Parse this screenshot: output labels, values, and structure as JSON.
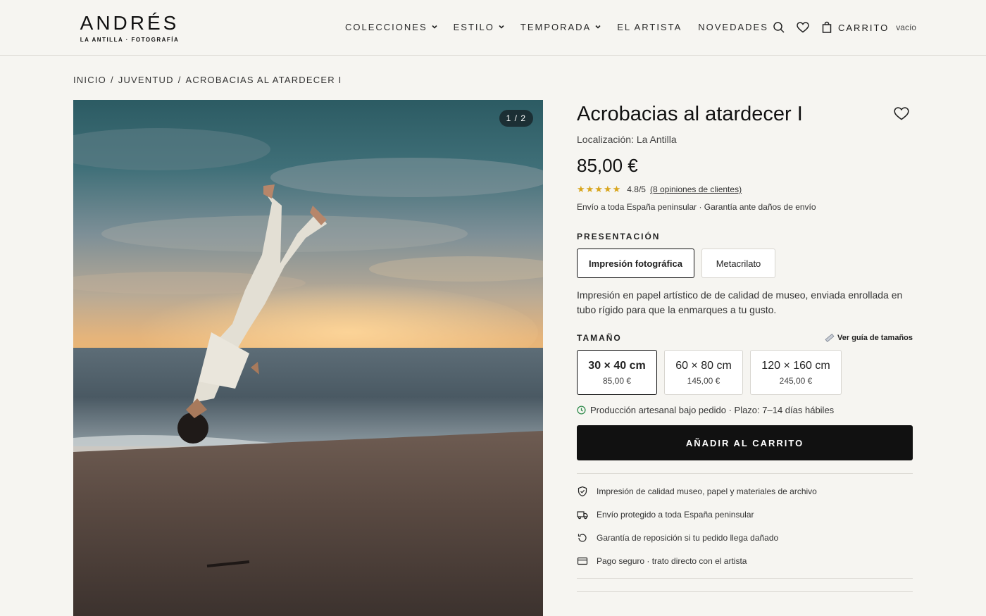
{
  "brand": {
    "name": "ANDRÉS",
    "tagline": "LA ANTILLA · FOTOGRAFÍA"
  },
  "nav": {
    "items": [
      {
        "label": "COLECCIONES",
        "dropdown": true
      },
      {
        "label": "ESTILO",
        "dropdown": true
      },
      {
        "label": "TEMPORADA",
        "dropdown": true
      },
      {
        "label": "EL ARTISTA",
        "dropdown": false
      },
      {
        "label": "NOVEDADES",
        "dropdown": false
      }
    ]
  },
  "header": {
    "cart_label": "CARRITO",
    "cart_state": "vacío"
  },
  "breadcrumb": [
    "INICIO",
    "JUVENTUD",
    "ACROBACIAS AL ATARDECER I"
  ],
  "gallery": {
    "counter": "1 / 2"
  },
  "product": {
    "title": "Acrobacias al atardecer I",
    "location": "Localización: La Antilla",
    "price": "85,00 €",
    "rating": {
      "stars": "★★★★★",
      "score": "4.8/5",
      "reviews": "(8 opiniones de clientes)"
    },
    "shipping_note": "Envío a toda España peninsular · Garantía ante daños de envío",
    "presentation": {
      "label": "PRESENTACIÓN",
      "options": [
        "Impresión fotográfica",
        "Metacrilato"
      ],
      "selected": "Impresión fotográfica",
      "description": "Impresión en papel artístico de de calidad de museo, enviada enrollada en tubo rígido para que la enmarques a tu gusto."
    },
    "size": {
      "label": "TAMAÑO",
      "guide": "Ver guía de tamaños",
      "options": [
        {
          "dim": "30 × 40 cm",
          "price": "85,00 €"
        },
        {
          "dim": "60 × 80 cm",
          "price": "145,00 €"
        },
        {
          "dim": "120 × 160 cm",
          "price": "245,00 €"
        }
      ],
      "selected": "30 × 40 cm"
    },
    "production": "Producción artesanal bajo pedido · Plazo: 7–14 días hábiles",
    "add_to_cart": "AÑADIR AL CARRITO",
    "features": [
      {
        "icon": "shield-check-icon",
        "text": "Impresión de calidad museo, papel y materiales de archivo"
      },
      {
        "icon": "truck-icon",
        "text": "Envío protegido a toda España peninsular"
      },
      {
        "icon": "refresh-icon",
        "text": "Garantía de reposición si tu pedido llega dañado"
      },
      {
        "icon": "credit-card-icon",
        "text": "Pago seguro · trato directo con el artista"
      }
    ]
  },
  "colors": {
    "background": "#f6f5f1",
    "accent": "#111111",
    "star": "#d8a51c",
    "success": "#2e8a4a"
  }
}
